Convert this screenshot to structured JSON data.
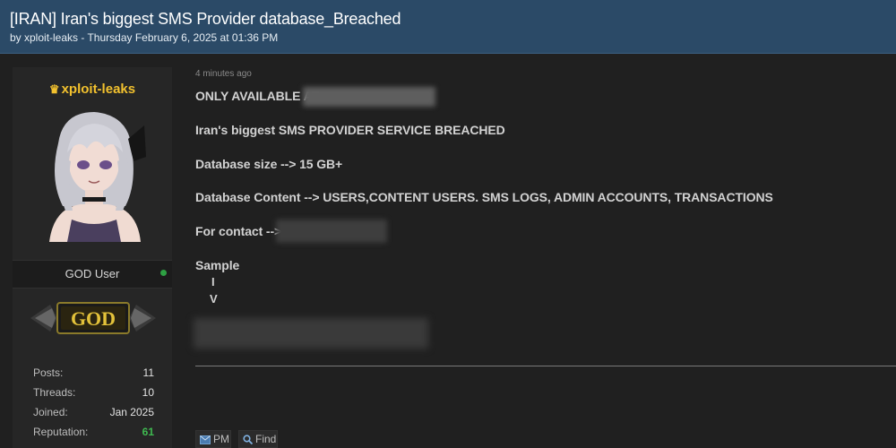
{
  "thread": {
    "title": "[IRAN] Iran's biggest SMS Provider database_Breached",
    "meta": "by xploit-leaks - Thursday February 6, 2025 at 01:36 PM"
  },
  "user": {
    "username": "xploit-leaks",
    "rank_title": "GOD User",
    "badge_text": "GOD",
    "stats": [
      {
        "label": "Posts:",
        "value": "11"
      },
      {
        "label": "Threads:",
        "value": "10"
      },
      {
        "label": "Joined:",
        "value": "Jan 2025"
      },
      {
        "label": "Reputation:",
        "value": "61"
      }
    ]
  },
  "post": {
    "time": "4 minutes ago",
    "line1": "ONLY AVAILABLE AT",
    "line2": "Iran's biggest SMS PROVIDER SERVICE BREACHED",
    "line3": "Database size --> 15 GB+",
    "line4": "Database Content --> USERS,CONTENT USERS. SMS LOGS, ADMIN ACCOUNTS, TRANSACTIONS",
    "line5": "For contact -->",
    "line6": "Sample",
    "arrow1": "I",
    "arrow2": "V"
  },
  "buttons": {
    "pm": "PM",
    "find": "Find"
  },
  "colors": {
    "header_bg": "#2b4a67",
    "username": "#f2c12e",
    "reputation": "#3fb950",
    "online": "#2ea043"
  }
}
